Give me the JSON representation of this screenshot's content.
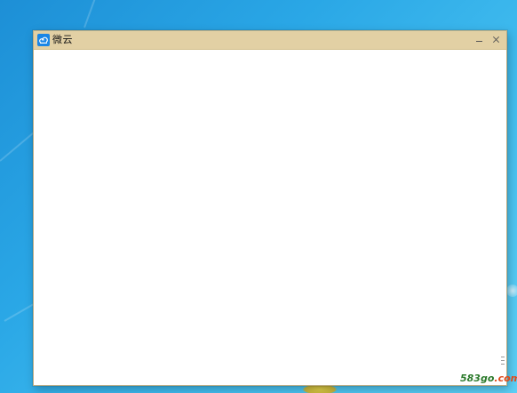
{
  "window": {
    "title": "微云",
    "icon": "cloud-icon",
    "minimize_icon": "minimize-icon",
    "close_icon": "close-icon"
  },
  "colors": {
    "titlebar": "#e2d0a4",
    "app_icon": "#1a86e6",
    "desktop": "#2aa7e6"
  },
  "watermark": {
    "part1": "583go",
    "part2": ".com"
  }
}
